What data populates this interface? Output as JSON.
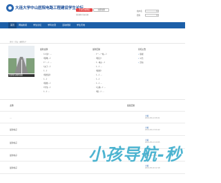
{
  "header": {
    "site_title": "大连大学中山医院电路工程建设学生论坛",
    "site_sub": "http://example",
    "login_label": "不得尽本网联",
    "register_label": "立即注册",
    "login_hint": "找回密码  快速注册",
    "user_label": "用户名",
    "pass_label": "密码"
  },
  "nav": {
    "items": [
      "首页",
      "网站新闻",
      "学生论坛",
      "学科交流",
      "活动视频",
      "学生天地"
    ]
  },
  "breadcrumb": "首页 › 论坛 › 最新帖子",
  "slider_caption": "北部新区道路风景图",
  "columns": {
    "left_title": "最新主题",
    "right_title": "最新回复",
    "left_items": [
      "《人生》…",
      "《随笔…》",
      "《一…》…",
      "《关于…》",
      "《…》",
      "《随想录》",
      "《…》",
      "《随便…》",
      "《学生…》",
      "《…》…"
    ],
    "right_items": [
      "《一…一帖…》",
      "《随记》",
      "《…电子…》",
      "《…》…",
      "《随想》",
      "《…》…",
      "《…》",
      "《…》…",
      "《心情…》…",
      "《随…》…"
    ]
  },
  "side": {
    "title": "论坛公告",
    "links": [
      "版规",
      "公告",
      "活动"
    ]
  },
  "list": {
    "head_left": "主题",
    "head_right": "最后回复",
    "rows": [
      {
        "title": "…",
        "reply": "小站",
        "time": "2019-05-12 08:21"
      },
      {
        "title": "最新帖子",
        "reply": "小站",
        "time": "2019-05-13 09:42"
      },
      {
        "title": "最新帖子",
        "reply": "小站",
        "time": "2019-05-14 10:05"
      },
      {
        "title": "最新帖子",
        "reply": "小站",
        "time": "2019-05-15 11:30"
      },
      {
        "title": "最新帖子",
        "reply": "小站",
        "time": "2019-05-16 12:18"
      }
    ]
  },
  "watermark": "小孩导航-秒",
  "colors": {
    "nav": "#1c5fa8",
    "login_button": "#e64545",
    "watermark": "#2ea8c9"
  }
}
